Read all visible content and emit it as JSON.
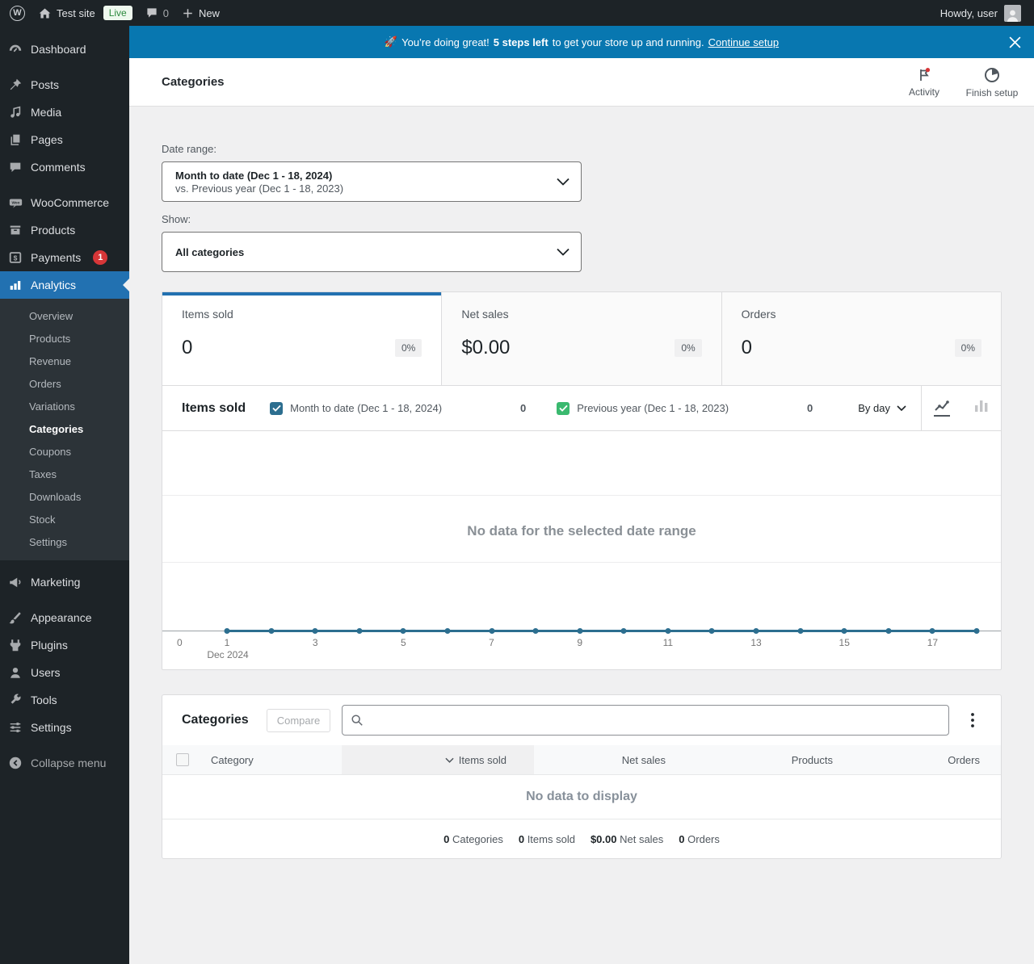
{
  "colors": {
    "accent_blue": "#2271b1",
    "banner_blue": "#0877b0",
    "badge_red": "#d63638",
    "chart_primary": "#2c6e8f",
    "chart_secondary": "#3ab96f"
  },
  "admin_bar": {
    "wp_logo": "W",
    "site_name": "Test site",
    "env_badge": "Live",
    "comments_count": "0",
    "new_label": "New",
    "howdy": "Howdy, user"
  },
  "sidebar": {
    "sections": [
      {
        "items": [
          {
            "icon": "dashboard-icon",
            "label": "Dashboard"
          }
        ]
      },
      {
        "items": [
          {
            "icon": "posts-icon",
            "label": "Posts"
          },
          {
            "icon": "media-icon",
            "label": "Media"
          },
          {
            "icon": "pages-icon",
            "label": "Pages"
          },
          {
            "icon": "comments-icon",
            "label": "Comments"
          }
        ]
      },
      {
        "items": [
          {
            "icon": "woocommerce-icon",
            "label": "WooCommerce"
          },
          {
            "icon": "products-icon",
            "label": "Products"
          },
          {
            "icon": "payments-icon",
            "label": "Payments",
            "badge": "1"
          },
          {
            "icon": "analytics-icon",
            "label": "Analytics",
            "active": true,
            "submenu": [
              {
                "label": "Overview"
              },
              {
                "label": "Products"
              },
              {
                "label": "Revenue"
              },
              {
                "label": "Orders"
              },
              {
                "label": "Variations"
              },
              {
                "label": "Categories",
                "active": true
              },
              {
                "label": "Coupons"
              },
              {
                "label": "Taxes"
              },
              {
                "label": "Downloads"
              },
              {
                "label": "Stock"
              },
              {
                "label": "Settings"
              }
            ]
          }
        ]
      },
      {
        "items": [
          {
            "icon": "marketing-icon",
            "label": "Marketing"
          }
        ]
      },
      {
        "items": [
          {
            "icon": "appearance-icon",
            "label": "Appearance"
          },
          {
            "icon": "plugins-icon",
            "label": "Plugins"
          },
          {
            "icon": "users-icon",
            "label": "Users"
          },
          {
            "icon": "tools-icon",
            "label": "Tools"
          },
          {
            "icon": "settings-icon",
            "label": "Settings"
          }
        ]
      },
      {
        "items": [
          {
            "icon": "collapse-icon",
            "label": "Collapse menu",
            "dim": true
          }
        ]
      }
    ]
  },
  "banner": {
    "emoji": "🚀",
    "msg_prefix": "You’re doing great!",
    "msg_bold": "5 steps left",
    "msg_suffix": "to get your store up and running.",
    "link": "Continue setup"
  },
  "page_header": {
    "title": "Categories",
    "actions": [
      {
        "label": "Activity",
        "icon": "flag-icon"
      },
      {
        "label": "Finish setup",
        "icon": "pie-clock-icon"
      }
    ]
  },
  "filters": {
    "date_range_label": "Date range:",
    "date_range_value": "Month to date (Dec 1 - 18, 2024)",
    "date_range_compare": "vs. Previous year (Dec 1 - 18, 2023)",
    "show_label": "Show:",
    "show_value": "All categories"
  },
  "summary_tiles": [
    {
      "label": "Items sold",
      "value": "0",
      "delta": "0%",
      "selected": true
    },
    {
      "label": "Net sales",
      "value": "$0.00",
      "delta": "0%",
      "selected": false
    },
    {
      "label": "Orders",
      "value": "0",
      "delta": "0%",
      "selected": false
    }
  ],
  "chart_section": {
    "title": "Items sold",
    "legend": [
      {
        "label": "Month to date (Dec 1 - 18, 2024)",
        "count": "0",
        "color": "#2c6e8f",
        "checked": true
      },
      {
        "label": "Previous year (Dec 1 - 18, 2023)",
        "count": "0",
        "color": "#3ab96f",
        "checked": true
      }
    ],
    "interval": "By day",
    "chart_type_active": "line",
    "empty_message": "No data for the selected date range"
  },
  "chart_data": {
    "type": "line",
    "title": "Items sold",
    "x": [
      1,
      2,
      3,
      4,
      5,
      6,
      7,
      8,
      9,
      10,
      11,
      12,
      13,
      14,
      15,
      16,
      17,
      18
    ],
    "x_tick_labels": [
      1,
      3,
      5,
      7,
      9,
      11,
      13,
      15,
      17
    ],
    "x_axis_caption": "Dec 2024",
    "y_zero_label": "0",
    "ylim": [
      0,
      0
    ],
    "grid": true,
    "legend_position": "top",
    "series": [
      {
        "name": "Month to date (Dec 1 - 18, 2024)",
        "color": "#2c6e8f",
        "values": [
          0,
          0,
          0,
          0,
          0,
          0,
          0,
          0,
          0,
          0,
          0,
          0,
          0,
          0,
          0,
          0,
          0,
          0
        ]
      },
      {
        "name": "Previous year (Dec 1 - 18, 2023)",
        "color": "#3ab96f",
        "values": [
          0,
          0,
          0,
          0,
          0,
          0,
          0,
          0,
          0,
          0,
          0,
          0,
          0,
          0,
          0,
          0,
          0,
          0
        ]
      }
    ]
  },
  "table_card": {
    "title": "Categories",
    "compare_label": "Compare",
    "search_placeholder": "",
    "columns": [
      {
        "label": "Category",
        "align": "left"
      },
      {
        "label": "Items sold",
        "align": "right",
        "sorted": "desc"
      },
      {
        "label": "Net sales",
        "align": "right"
      },
      {
        "label": "Products",
        "align": "right"
      },
      {
        "label": "Orders",
        "align": "right"
      }
    ],
    "empty_message": "No data to display",
    "summary": [
      {
        "value": "0",
        "label": "Categories"
      },
      {
        "value": "0",
        "label": "Items sold"
      },
      {
        "value": "$0.00",
        "label": "Net sales"
      },
      {
        "value": "0",
        "label": "Orders"
      }
    ]
  }
}
